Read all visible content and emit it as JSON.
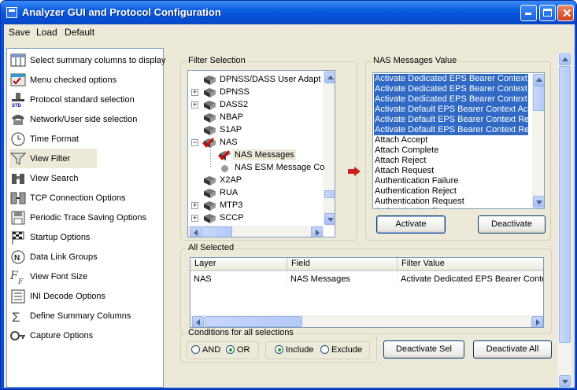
{
  "window": {
    "title": "Analyzer GUI and Protocol Configuration"
  },
  "menu": {
    "save": "Save",
    "load": "Load",
    "default": "Default"
  },
  "sidebar": {
    "items": [
      {
        "label": "Select summary columns to display",
        "icon": "columns-icon"
      },
      {
        "label": "Menu checked options",
        "icon": "menu-check-icon"
      },
      {
        "label": "Protocol standard selection",
        "icon": "standard-icon"
      },
      {
        "label": "Network/User side selection",
        "icon": "network-phone-icon"
      },
      {
        "label": "Time Format",
        "icon": "clock-icon"
      },
      {
        "label": "View Filter",
        "icon": "funnel-icon"
      },
      {
        "label": "View Search",
        "icon": "binoculars-icon"
      },
      {
        "label": "TCP Connection Options",
        "icon": "tcp-icon"
      },
      {
        "label": "Periodic Trace Saving Options",
        "icon": "trace-save-icon"
      },
      {
        "label": "Startup Options",
        "icon": "startup-flag-icon"
      },
      {
        "label": "Data Link Groups",
        "icon": "data-link-icon"
      },
      {
        "label": "View Font Size",
        "icon": "font-size-icon"
      },
      {
        "label": "INI Decode Options",
        "icon": "ini-decode-icon"
      },
      {
        "label": "Define Summary Columns",
        "icon": "sigma-icon"
      },
      {
        "label": "Capture Options",
        "icon": "capture-icon"
      }
    ],
    "selected": "View Filter"
  },
  "filter": {
    "title": "Filter Selection",
    "tree": [
      {
        "label": "DPNSS/DASS User Adapt",
        "level": 1,
        "expander": ""
      },
      {
        "label": "DPNSS",
        "level": 1,
        "expander": "+"
      },
      {
        "label": "DASS2",
        "level": 1,
        "expander": "+"
      },
      {
        "label": "NBAP",
        "level": 1,
        "expander": ""
      },
      {
        "label": "S1AP",
        "level": 1,
        "expander": ""
      },
      {
        "label": "NAS",
        "level": 1,
        "expander": "-",
        "checked": true
      },
      {
        "label": "NAS Messages",
        "level": 2,
        "checked": true,
        "selected": true
      },
      {
        "label": "NAS ESM Message Co",
        "level": 2,
        "dot": true
      },
      {
        "label": "X2AP",
        "level": 1,
        "expander": ""
      },
      {
        "label": "RUA",
        "level": 1,
        "expander": ""
      },
      {
        "label": "MTP3",
        "level": 1,
        "expander": "+"
      },
      {
        "label": "SCCP",
        "level": 1,
        "expander": "+"
      }
    ]
  },
  "values": {
    "title": "NAS Messages Value",
    "items": [
      {
        "label": "Activate Dedicated EPS Bearer Context A",
        "selected": true
      },
      {
        "label": "Activate Dedicated EPS Bearer Context R",
        "selected": true
      },
      {
        "label": "Activate Dedicated EPS Bearer Context R",
        "selected": true
      },
      {
        "label": "Activate Default EPS Bearer Context Acc",
        "selected": true
      },
      {
        "label": "Activate Default EPS Bearer Context Reje",
        "selected": true
      },
      {
        "label": "Activate Default EPS Bearer Context Req",
        "selected": true
      },
      {
        "label": "Attach Accept",
        "selected": false
      },
      {
        "label": "Attach Complete",
        "selected": false
      },
      {
        "label": "Attach Reject",
        "selected": false
      },
      {
        "label": "Attach Request",
        "selected": false
      },
      {
        "label": "Authentication Failure",
        "selected": false
      },
      {
        "label": "Authentication Reject",
        "selected": false
      },
      {
        "label": "Authentication Request",
        "selected": false
      },
      {
        "label": "Authentication Response",
        "selected": false
      }
    ],
    "activate": "Activate",
    "deactivate": "Deactivate"
  },
  "all_selected": {
    "title": "All Selected",
    "columns": [
      "Layer",
      "Field",
      "Filter Value"
    ],
    "rows": [
      [
        "NAS",
        "NAS Messages",
        "Activate Dedicated EPS Bearer Conte"
      ]
    ]
  },
  "conditions": {
    "title": "Conditions for all selections",
    "and": "AND",
    "or": "OR",
    "include": "Include",
    "exclude": "Exclude",
    "logic_selected": "OR",
    "mode_selected": "Include"
  },
  "buttons": {
    "deactivate_sel": "Deactivate Sel",
    "deactivate_all": "Deactivate All"
  }
}
